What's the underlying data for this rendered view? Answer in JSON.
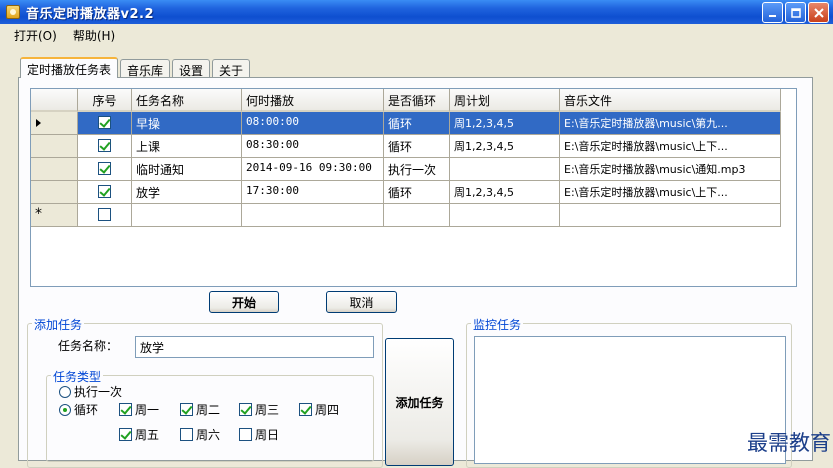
{
  "window": {
    "title": "音乐定时播放器v2.2"
  },
  "menu": [
    "打开(O)",
    "帮助(H)"
  ],
  "tabs": [
    "定时播放任务表",
    "音乐库",
    "设置",
    "关于"
  ],
  "grid": {
    "columns": [
      "序号",
      "任务名称",
      "何时播放",
      "是否循环",
      "周计划",
      "音乐文件"
    ],
    "rows": [
      {
        "checked": true,
        "name": "早操",
        "time": "08:00:00",
        "loop": "循环",
        "week": "周1,2,3,4,5",
        "file": "E:\\音乐定时播放器\\music\\第九..."
      },
      {
        "checked": true,
        "name": "上课",
        "time": "08:30:00",
        "loop": "循环",
        "week": "周1,2,3,4,5",
        "file": "E:\\音乐定时播放器\\music\\上下..."
      },
      {
        "checked": true,
        "name": "临时通知",
        "time": "2014-09-16 09:30:00",
        "loop": "执行一次",
        "week": "",
        "file": "E:\\音乐定时播放器\\music\\通知.mp3"
      },
      {
        "checked": true,
        "name": "放学",
        "time": "17:30:00",
        "loop": "循环",
        "week": "周1,2,3,4,5",
        "file": "E:\\音乐定时播放器\\music\\上下..."
      }
    ],
    "new_row_marker": "*"
  },
  "buttons": {
    "start": "开始",
    "cancel": "取消",
    "add_task": "添加任务"
  },
  "add_task": {
    "title": "添加任务",
    "name_label": "任务名称：",
    "name_value": "放学",
    "type_group": "任务类型",
    "once_label": "执行一次",
    "loop_label": "循环",
    "days": [
      {
        "label": "周一",
        "checked": true
      },
      {
        "label": "周二",
        "checked": true
      },
      {
        "label": "周三",
        "checked": true
      },
      {
        "label": "周四",
        "checked": true
      },
      {
        "label": "周五",
        "checked": true
      },
      {
        "label": "周六",
        "checked": false
      },
      {
        "label": "周日",
        "checked": false
      }
    ]
  },
  "monitor": {
    "title": "监控任务"
  },
  "watermark": "最需教育"
}
